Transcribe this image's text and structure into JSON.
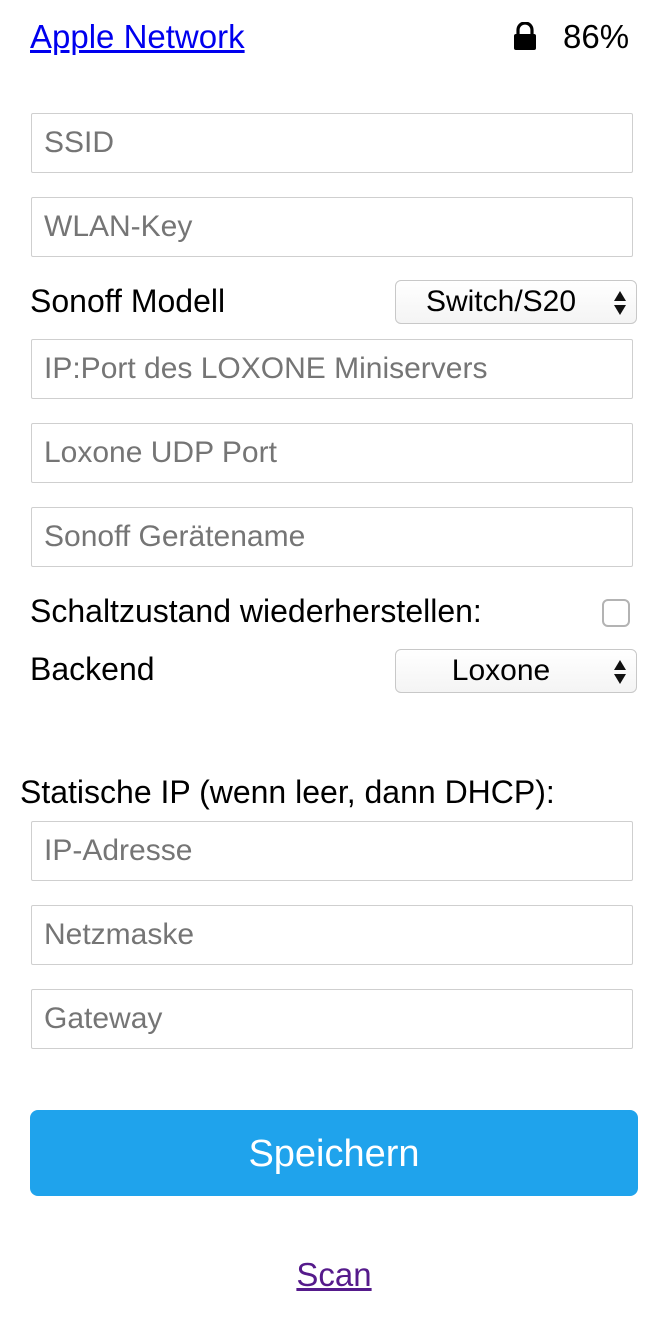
{
  "header": {
    "network_name": "Apple Network",
    "lock_icon": "lock-icon",
    "signal_strength": "86%"
  },
  "wifi": {
    "ssid": {
      "value": "",
      "placeholder": "SSID"
    },
    "key": {
      "value": "",
      "placeholder": "WLAN-Key"
    }
  },
  "device": {
    "model_label": "Sonoff Modell",
    "model_selected": "Switch/S20",
    "miniserver": {
      "value": "",
      "placeholder": "IP:Port des LOXONE Miniservers"
    },
    "udp_port": {
      "value": "",
      "placeholder": "Loxone UDP Port"
    },
    "device_name": {
      "value": "",
      "placeholder": "Sonoff Gerätename"
    },
    "restore_state_label": "Schaltzustand wiederherstellen:",
    "restore_state_checked": false,
    "backend_label": "Backend",
    "backend_selected": "Loxone"
  },
  "static_ip": {
    "title": "Statische IP (wenn leer, dann DHCP):",
    "ip": {
      "value": "",
      "placeholder": "IP-Adresse"
    },
    "netmask": {
      "value": "",
      "placeholder": "Netzmaske"
    },
    "gateway": {
      "value": "",
      "placeholder": "Gateway"
    }
  },
  "actions": {
    "save_label": "Speichern",
    "scan_label": "Scan"
  },
  "colors": {
    "button": "#1fa3ec",
    "link": "#0000ee",
    "visited_link": "#551a8b"
  }
}
